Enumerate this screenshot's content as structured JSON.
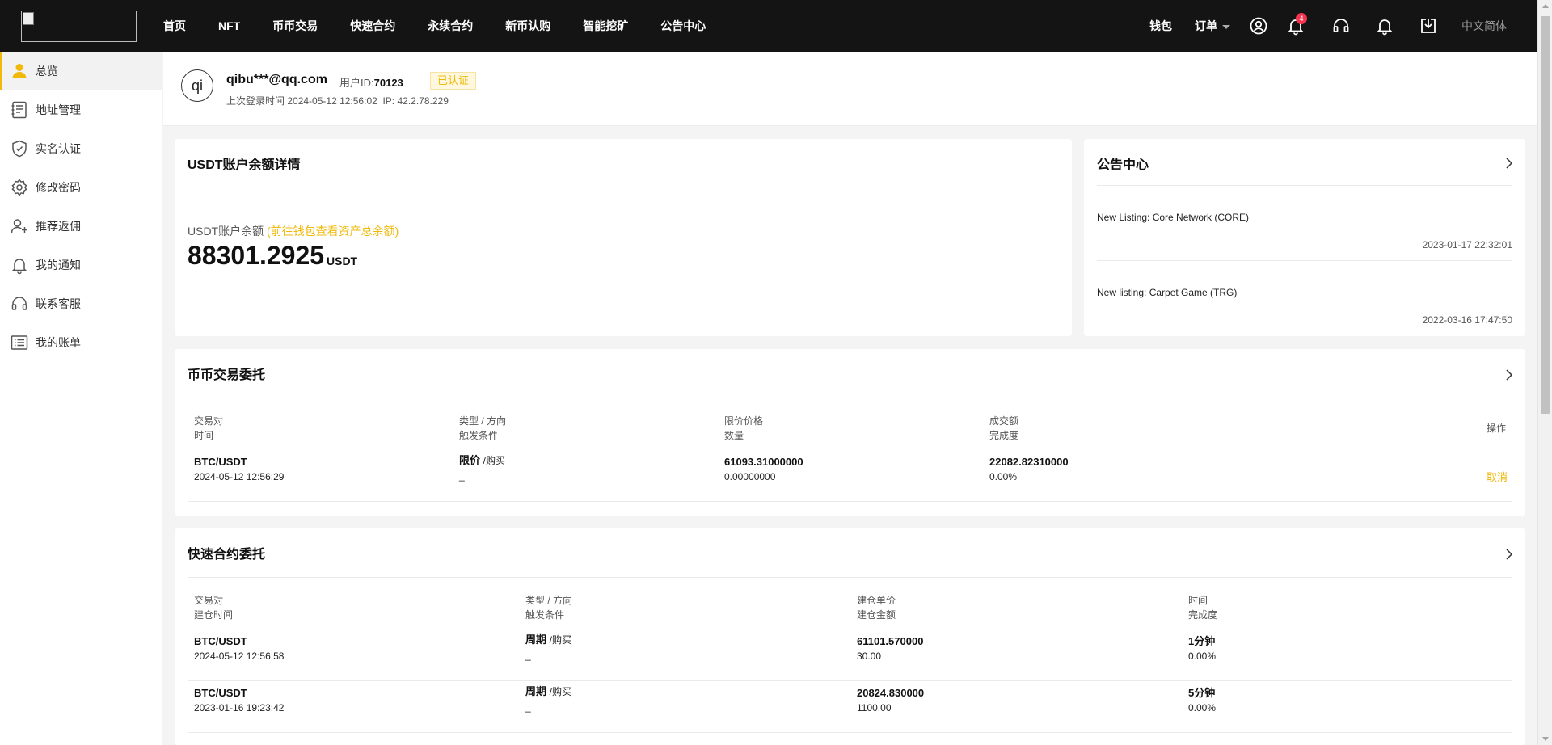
{
  "nav": {
    "items": [
      "首页",
      "NFT",
      "币币交易",
      "快速合约",
      "永续合约",
      "新币认购",
      "智能挖矿",
      "公告中心"
    ],
    "wallet": "钱包",
    "orders": "订单",
    "notification_count": "4",
    "language": "中文简体",
    "icons": [
      "user-circle-icon",
      "bell-icon",
      "headset-icon",
      "bell-icon",
      "download-icon"
    ]
  },
  "sidebar": {
    "items": [
      {
        "label": "总览",
        "icon": "user-icon",
        "active": true
      },
      {
        "label": "地址管理",
        "icon": "address-book-icon",
        "active": false
      },
      {
        "label": "实名认证",
        "icon": "shield-check-icon",
        "active": false
      },
      {
        "label": "修改密码",
        "icon": "gear-icon",
        "active": false
      },
      {
        "label": "推荐返佣",
        "icon": "user-add-icon",
        "active": false
      },
      {
        "label": "我的通知",
        "icon": "bell-icon",
        "active": false
      },
      {
        "label": "联系客服",
        "icon": "headset-icon",
        "active": false
      },
      {
        "label": "我的账单",
        "icon": "list-icon",
        "active": false
      }
    ]
  },
  "user": {
    "avatar_text": "qi",
    "email": "qibu***@qq.com",
    "uid_label": "用户ID:",
    "uid": "70123",
    "verified": "已认证",
    "last_login_label": "上次登录时间",
    "last_login_time": "2024-05-12 12:56:02",
    "ip_label": "IP:",
    "ip": "42.2.78.229"
  },
  "balance": {
    "title": "USDT账户余额详情",
    "label": "USDT账户余额",
    "link": "(前往钱包查看资产总余额)",
    "amount": "88301.2925",
    "unit": "USDT"
  },
  "notices": {
    "title": "公告中心",
    "items": [
      {
        "title": "New Listing: Core Network (CORE)",
        "time": "2023-01-17 22:32:01"
      },
      {
        "title": "New listing: Carpet Game (TRG)",
        "time": "2022-03-16 17:47:50"
      }
    ]
  },
  "spot_orders": {
    "title": "币币交易委托",
    "headers": [
      {
        "top": "交易对",
        "bottom": "时间"
      },
      {
        "top": "类型 / 方向",
        "bottom": "触发条件"
      },
      {
        "top": "限价价格",
        "bottom": "数量"
      },
      {
        "top": "成交额",
        "bottom": "完成度"
      },
      {
        "top": "操作",
        "bottom": ""
      }
    ],
    "rows": [
      {
        "pair": "BTC/USDT",
        "time": "2024-05-12 12:56:29",
        "type": "限价",
        "direction": "/购买",
        "trigger": "_",
        "price": "61093.31000000",
        "qty": "0.00000000",
        "amount": "22082.82310000",
        "progress": "0.00%",
        "action": "取消"
      }
    ]
  },
  "quick_orders": {
    "title": "快速合约委托",
    "headers": [
      {
        "top": "交易对",
        "bottom": "建仓时间"
      },
      {
        "top": "类型 / 方向",
        "bottom": "触发条件"
      },
      {
        "top": "建仓单价",
        "bottom": "建仓金额"
      },
      {
        "top": "时间",
        "bottom": "完成度"
      }
    ],
    "rows": [
      {
        "pair": "BTC/USDT",
        "time": "2024-05-12 12:56:58",
        "type": "周期",
        "direction": "/购买",
        "trigger": "_",
        "price": "61101.570000",
        "amount": "30.00",
        "period": "1分钟",
        "progress": "0.00%"
      },
      {
        "pair": "BTC/USDT",
        "time": "2023-01-16 19:23:42",
        "type": "周期",
        "direction": "/购买",
        "trigger": "_",
        "price": "20824.830000",
        "amount": "1100.00",
        "period": "5分钟",
        "progress": "0.00%"
      }
    ]
  },
  "colors": {
    "accent": "#f0b90b",
    "buy": "#00b86b",
    "nav_bg": "#141414",
    "badge": "#f5334f"
  }
}
